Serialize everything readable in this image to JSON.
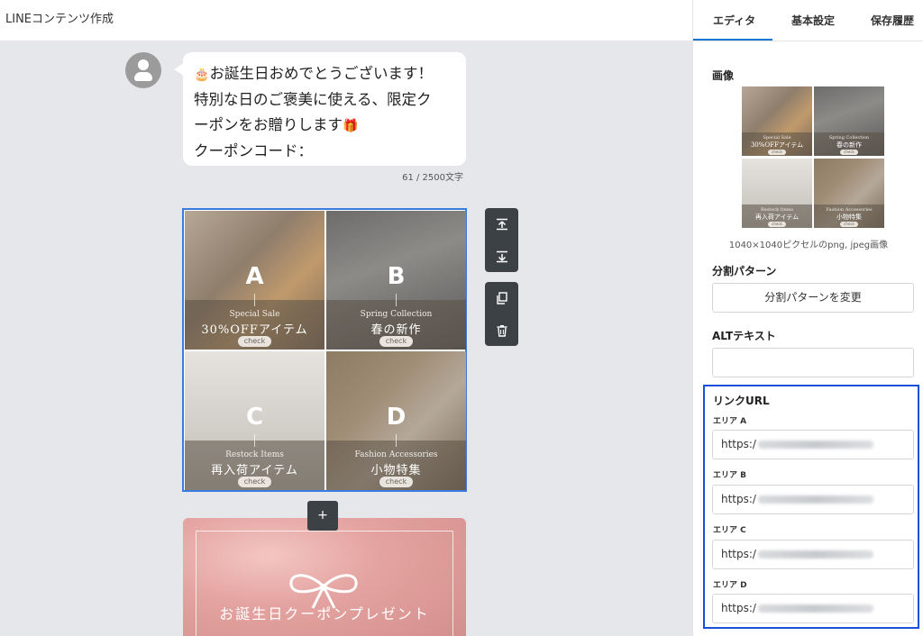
{
  "app": {
    "title": "LINEコンテンツ作成"
  },
  "message": {
    "lines": [
      "お誕生日おめでとうございます！",
      "特別な日のご褒美に使える、限定ク",
      "ーポンをお贈りします",
      "クーポンコード："
    ],
    "emoji_cake": "🎂",
    "emoji_gift": "🎁",
    "counter": "61 / 2500文字"
  },
  "imagemap": {
    "cells": [
      {
        "letter": "A",
        "sub": "Special Sale",
        "main": "30%OFFアイテム",
        "check": "check"
      },
      {
        "letter": "B",
        "sub": "Spring Collection",
        "main": "春の新作",
        "check": "check"
      },
      {
        "letter": "C",
        "sub": "Restock Items",
        "main": "再入荷アイテム",
        "check": "check"
      },
      {
        "letter": "D",
        "sub": "Fashion Accessories",
        "main": "小物特集",
        "check": "check"
      }
    ]
  },
  "toolbar": {
    "move_up_icon": "move-up-icon",
    "move_down_icon": "move-down-icon",
    "copy_icon": "copy-icon",
    "delete_icon": "trash-icon",
    "add_label": "+"
  },
  "banner": {
    "title": "お誕生日クーポンプレゼント"
  },
  "panel": {
    "tabs": [
      "エディタ",
      "基本設定",
      "保存履歴"
    ],
    "active_tab": "エディタ",
    "image_label": "画像",
    "image_caption": "1040×1040ピクセルのpng, jpeg画像",
    "split_label": "分割パターン",
    "split_button": "分割パターンを変更",
    "alt_label": "ALTテキスト",
    "alt_value": "",
    "link_label": "リンクURL",
    "areas": [
      {
        "label": "エリア A",
        "url_prefix": "https:/"
      },
      {
        "label": "エリア B",
        "url_prefix": "https:/"
      },
      {
        "label": "エリア C",
        "url_prefix": "https:/"
      },
      {
        "label": "エリア D",
        "url_prefix": "https:/"
      }
    ]
  },
  "colors": {
    "accent": "#1976d2",
    "highlight_border": "#1a4fd8",
    "selection_border": "#3b7bdd",
    "toolbar_bg": "#3c4146",
    "canvas_bg": "#e6e7eb"
  }
}
